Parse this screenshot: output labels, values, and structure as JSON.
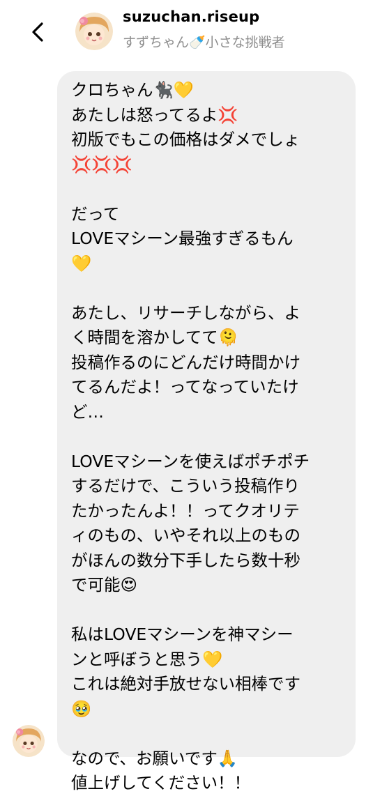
{
  "header": {
    "back_icon": "chevron-left-icon",
    "username": "suzuchan.riseup",
    "subtitle": "すずちゃん🍼小さな挑戦者"
  },
  "message": {
    "lines": [
      "クロちゃん🐈‍⬛💛",
      "あたしは怒ってるよ💢",
      "初版でもこの価格はダメでしょ",
      "💢💢💢",
      "",
      "だって",
      "LOVEマシーン最強すぎるもん",
      "💛",
      "",
      "あたし、リサーチしながら、よ",
      "く時間を溶かしてて🫠",
      "投稿作るのにどんだけ時間かけ",
      "てるんだよ！ってなっていたけ",
      "ど…",
      "",
      "LOVEマシーンを使えばポチポチ",
      "するだけで、こういう投稿作り",
      "たかったんよ！！ってクオリテ",
      "ィのもの、いやそれ以上のもの",
      "がほんの数分下手したら数十秒",
      "で可能😍",
      "",
      "私はLOVEマシーンを神マシー",
      "ンと呼ぼうと思う💛",
      "これは絶対手放せない相棒です",
      "🥹",
      "",
      "なので、お願いです🙏",
      "値上げしてください！！"
    ]
  },
  "colors": {
    "bubble": "#efefef",
    "subtitle": "#8e8e8e"
  }
}
